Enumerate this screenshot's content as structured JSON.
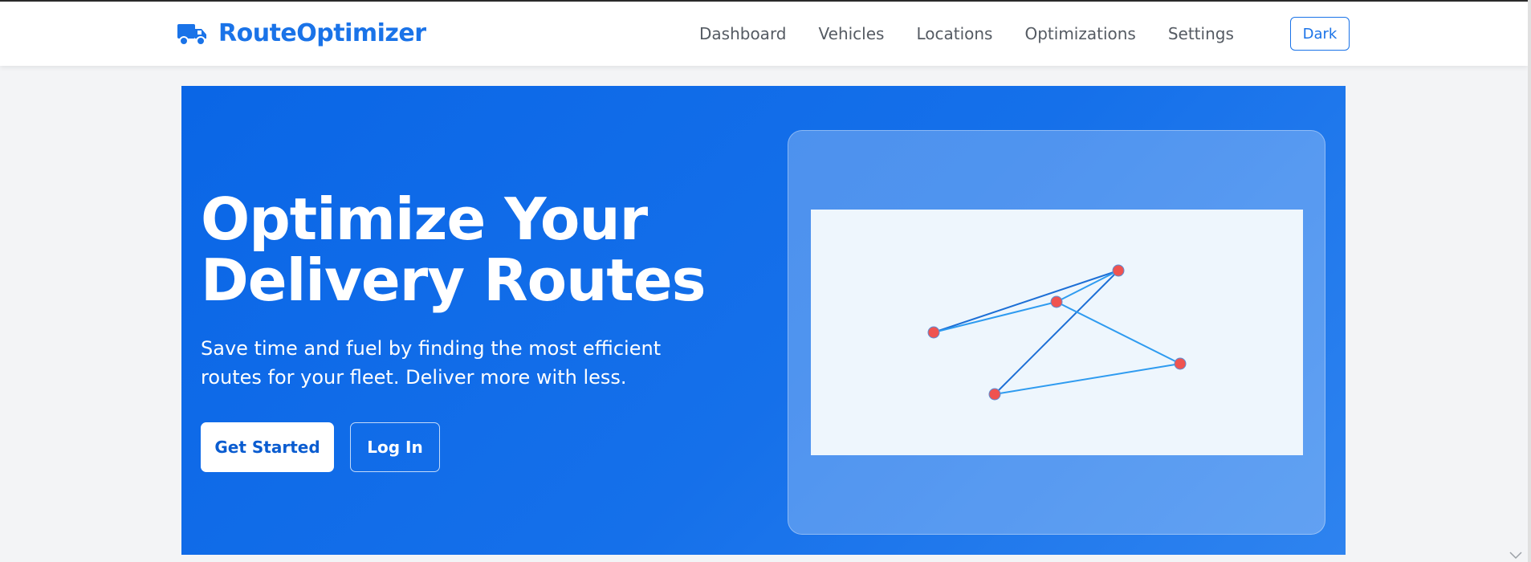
{
  "app": {
    "brand_name": "RouteOptimizer",
    "brand_icon": "truck-icon",
    "accent_color": "#1a73e8"
  },
  "nav": {
    "items": [
      {
        "label": "Dashboard"
      },
      {
        "label": "Vehicles"
      },
      {
        "label": "Locations"
      },
      {
        "label": "Optimizations"
      },
      {
        "label": "Settings"
      }
    ],
    "theme_toggle_label": "Dark"
  },
  "hero": {
    "title_line1": "Optimize Your",
    "title_line2": "Delivery Routes",
    "subtitle": "Save time and fuel by finding the most efficient routes for your fleet. Deliver more with less.",
    "primary_button": "Get Started",
    "secondary_button": "Log In"
  },
  "route_map": {
    "stop_count": 5,
    "stop_color": "#ef5350",
    "route_color": "#2e9bf0"
  }
}
